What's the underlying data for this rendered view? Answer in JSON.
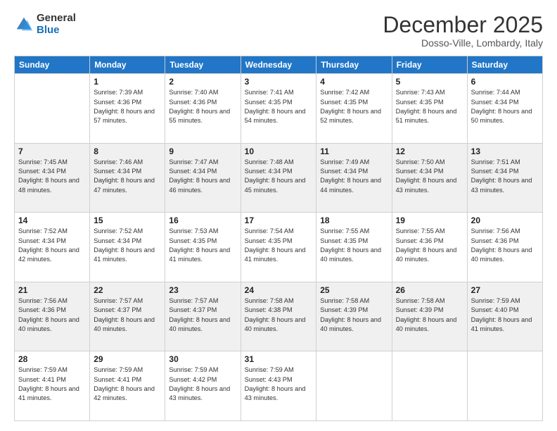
{
  "logo": {
    "general": "General",
    "blue": "Blue"
  },
  "title": {
    "month": "December 2025",
    "location": "Dosso-Ville, Lombardy, Italy"
  },
  "weekdays": [
    "Sunday",
    "Monday",
    "Tuesday",
    "Wednesday",
    "Thursday",
    "Friday",
    "Saturday"
  ],
  "weeks": [
    [
      {
        "day": "",
        "sunrise": "",
        "sunset": "",
        "daylight": ""
      },
      {
        "day": "1",
        "sunrise": "Sunrise: 7:39 AM",
        "sunset": "Sunset: 4:36 PM",
        "daylight": "Daylight: 8 hours and 57 minutes."
      },
      {
        "day": "2",
        "sunrise": "Sunrise: 7:40 AM",
        "sunset": "Sunset: 4:36 PM",
        "daylight": "Daylight: 8 hours and 55 minutes."
      },
      {
        "day": "3",
        "sunrise": "Sunrise: 7:41 AM",
        "sunset": "Sunset: 4:35 PM",
        "daylight": "Daylight: 8 hours and 54 minutes."
      },
      {
        "day": "4",
        "sunrise": "Sunrise: 7:42 AM",
        "sunset": "Sunset: 4:35 PM",
        "daylight": "Daylight: 8 hours and 52 minutes."
      },
      {
        "day": "5",
        "sunrise": "Sunrise: 7:43 AM",
        "sunset": "Sunset: 4:35 PM",
        "daylight": "Daylight: 8 hours and 51 minutes."
      },
      {
        "day": "6",
        "sunrise": "Sunrise: 7:44 AM",
        "sunset": "Sunset: 4:34 PM",
        "daylight": "Daylight: 8 hours and 50 minutes."
      }
    ],
    [
      {
        "day": "7",
        "sunrise": "Sunrise: 7:45 AM",
        "sunset": "Sunset: 4:34 PM",
        "daylight": "Daylight: 8 hours and 48 minutes."
      },
      {
        "day": "8",
        "sunrise": "Sunrise: 7:46 AM",
        "sunset": "Sunset: 4:34 PM",
        "daylight": "Daylight: 8 hours and 47 minutes."
      },
      {
        "day": "9",
        "sunrise": "Sunrise: 7:47 AM",
        "sunset": "Sunset: 4:34 PM",
        "daylight": "Daylight: 8 hours and 46 minutes."
      },
      {
        "day": "10",
        "sunrise": "Sunrise: 7:48 AM",
        "sunset": "Sunset: 4:34 PM",
        "daylight": "Daylight: 8 hours and 45 minutes."
      },
      {
        "day": "11",
        "sunrise": "Sunrise: 7:49 AM",
        "sunset": "Sunset: 4:34 PM",
        "daylight": "Daylight: 8 hours and 44 minutes."
      },
      {
        "day": "12",
        "sunrise": "Sunrise: 7:50 AM",
        "sunset": "Sunset: 4:34 PM",
        "daylight": "Daylight: 8 hours and 43 minutes."
      },
      {
        "day": "13",
        "sunrise": "Sunrise: 7:51 AM",
        "sunset": "Sunset: 4:34 PM",
        "daylight": "Daylight: 8 hours and 43 minutes."
      }
    ],
    [
      {
        "day": "14",
        "sunrise": "Sunrise: 7:52 AM",
        "sunset": "Sunset: 4:34 PM",
        "daylight": "Daylight: 8 hours and 42 minutes."
      },
      {
        "day": "15",
        "sunrise": "Sunrise: 7:52 AM",
        "sunset": "Sunset: 4:34 PM",
        "daylight": "Daylight: 8 hours and 41 minutes."
      },
      {
        "day": "16",
        "sunrise": "Sunrise: 7:53 AM",
        "sunset": "Sunset: 4:35 PM",
        "daylight": "Daylight: 8 hours and 41 minutes."
      },
      {
        "day": "17",
        "sunrise": "Sunrise: 7:54 AM",
        "sunset": "Sunset: 4:35 PM",
        "daylight": "Daylight: 8 hours and 41 minutes."
      },
      {
        "day": "18",
        "sunrise": "Sunrise: 7:55 AM",
        "sunset": "Sunset: 4:35 PM",
        "daylight": "Daylight: 8 hours and 40 minutes."
      },
      {
        "day": "19",
        "sunrise": "Sunrise: 7:55 AM",
        "sunset": "Sunset: 4:36 PM",
        "daylight": "Daylight: 8 hours and 40 minutes."
      },
      {
        "day": "20",
        "sunrise": "Sunrise: 7:56 AM",
        "sunset": "Sunset: 4:36 PM",
        "daylight": "Daylight: 8 hours and 40 minutes."
      }
    ],
    [
      {
        "day": "21",
        "sunrise": "Sunrise: 7:56 AM",
        "sunset": "Sunset: 4:36 PM",
        "daylight": "Daylight: 8 hours and 40 minutes."
      },
      {
        "day": "22",
        "sunrise": "Sunrise: 7:57 AM",
        "sunset": "Sunset: 4:37 PM",
        "daylight": "Daylight: 8 hours and 40 minutes."
      },
      {
        "day": "23",
        "sunrise": "Sunrise: 7:57 AM",
        "sunset": "Sunset: 4:37 PM",
        "daylight": "Daylight: 8 hours and 40 minutes."
      },
      {
        "day": "24",
        "sunrise": "Sunrise: 7:58 AM",
        "sunset": "Sunset: 4:38 PM",
        "daylight": "Daylight: 8 hours and 40 minutes."
      },
      {
        "day": "25",
        "sunrise": "Sunrise: 7:58 AM",
        "sunset": "Sunset: 4:39 PM",
        "daylight": "Daylight: 8 hours and 40 minutes."
      },
      {
        "day": "26",
        "sunrise": "Sunrise: 7:58 AM",
        "sunset": "Sunset: 4:39 PM",
        "daylight": "Daylight: 8 hours and 40 minutes."
      },
      {
        "day": "27",
        "sunrise": "Sunrise: 7:59 AM",
        "sunset": "Sunset: 4:40 PM",
        "daylight": "Daylight: 8 hours and 41 minutes."
      }
    ],
    [
      {
        "day": "28",
        "sunrise": "Sunrise: 7:59 AM",
        "sunset": "Sunset: 4:41 PM",
        "daylight": "Daylight: 8 hours and 41 minutes."
      },
      {
        "day": "29",
        "sunrise": "Sunrise: 7:59 AM",
        "sunset": "Sunset: 4:41 PM",
        "daylight": "Daylight: 8 hours and 42 minutes."
      },
      {
        "day": "30",
        "sunrise": "Sunrise: 7:59 AM",
        "sunset": "Sunset: 4:42 PM",
        "daylight": "Daylight: 8 hours and 43 minutes."
      },
      {
        "day": "31",
        "sunrise": "Sunrise: 7:59 AM",
        "sunset": "Sunset: 4:43 PM",
        "daylight": "Daylight: 8 hours and 43 minutes."
      },
      {
        "day": "",
        "sunrise": "",
        "sunset": "",
        "daylight": ""
      },
      {
        "day": "",
        "sunrise": "",
        "sunset": "",
        "daylight": ""
      },
      {
        "day": "",
        "sunrise": "",
        "sunset": "",
        "daylight": ""
      }
    ]
  ]
}
